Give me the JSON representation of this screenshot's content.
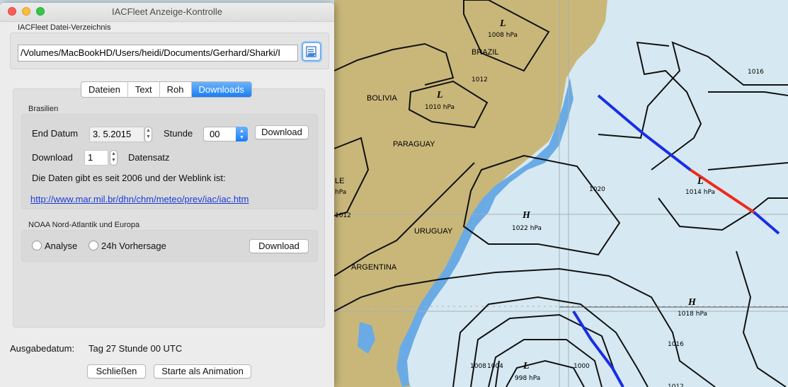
{
  "window": {
    "title": "IACFleet Anzeige-Kontrolle"
  },
  "directory": {
    "label": "IACFleet Datei-Verzeichnis",
    "path": "/Volumes/MacBookHD/Users/heidi/Documents/Gerhard/Sharki/I"
  },
  "tabs": [
    {
      "label": "Dateien"
    },
    {
      "label": "Text"
    },
    {
      "label": "Roh"
    },
    {
      "label": "Downloads",
      "active": true
    }
  ],
  "brasilien": {
    "section_label": "Brasilien",
    "end_datum_label": "End Datum",
    "end_datum_value": "3.  5.2015",
    "stunde_label": "Stunde",
    "stunde_value": "00",
    "download_button": "Download",
    "download_label": "Download",
    "download_count": "1",
    "datensatz_label": "Datensatz",
    "info_text": "Die Daten gibt es seit 2006 und der Weblink ist:",
    "weblink": "http://www.mar.mil.br/dhn/chm/meteo/prev/iac/iac.htm"
  },
  "noaa": {
    "section_label": "NOAA Nord-Atlantik und Europa",
    "analyse_label": "Analyse",
    "vorhersage_label": "24h Vorhersage",
    "download_button": "Download"
  },
  "footer": {
    "ausgabedatum_label": "Ausgabedatum:",
    "ausgabedatum_value": "Tag 27 Stunde 00 UTC",
    "close_button": "Schließen",
    "animation_button": "Starte als Animation"
  },
  "map": {
    "colors": {
      "ocean": "#d6e9f2",
      "land": "#c9b77a",
      "water": "#6aabe5"
    },
    "country_labels": [
      "BRAZIL",
      "BOLIVIA",
      "PARAGUAY",
      "URUGUAY",
      "ARGENTINA",
      "LE"
    ],
    "pressure_systems": [
      {
        "symbol": "L",
        "value": "1008 hPa"
      },
      {
        "symbol": "L",
        "value": "1010 hPa"
      },
      {
        "symbol": "H",
        "value": "1022 hPa"
      },
      {
        "symbol": "L",
        "value": "1014 hPa"
      },
      {
        "symbol": "H",
        "value": "1018 hPa"
      },
      {
        "symbol": "L",
        "value": "998 hPa"
      },
      {
        "symbol": "",
        "value": "hPa"
      }
    ],
    "isobar_labels": [
      "1012",
      "1016",
      "1020",
      "1016",
      "1012",
      "1008",
      "1004",
      "1000",
      "1012"
    ]
  }
}
